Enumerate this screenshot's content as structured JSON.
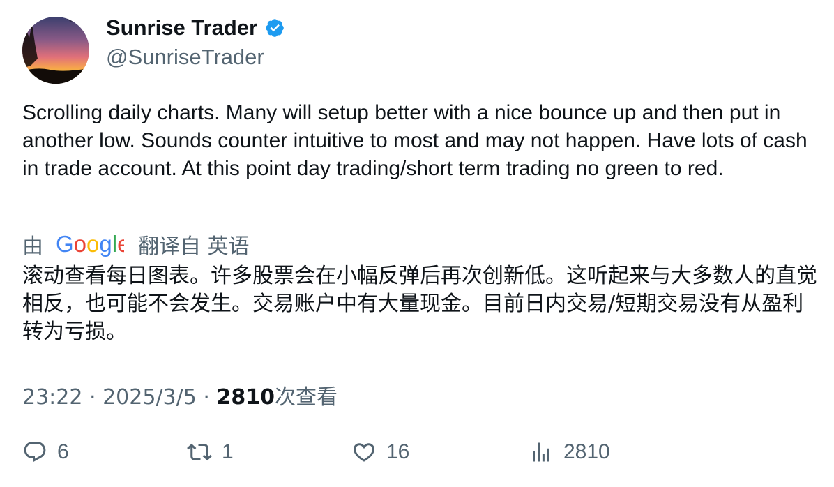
{
  "author": {
    "name": "Sunrise Trader",
    "handle": "@SunriseTrader",
    "verified_icon": "verified-badge-icon",
    "avatar_icon": "sunset-landscape-avatar"
  },
  "tweet": {
    "text": "Scrolling daily charts. Many will setup better with a nice bounce up and then put in another low. Sounds counter intuitive to most and may not happen.  Have lots of cash in trade account. At this point day trading/short term trading no green to red."
  },
  "translation": {
    "by_label": "由",
    "logo_text": "Google",
    "from_label": "翻译自 英语",
    "text": "滚动查看每日图表。许多股票会在小幅反弹后再次创新低。这听起来与大多数人的直觉相反，也可能不会发生。交易账户中有大量现金。目前日内交易/短期交易没有从盈利转为亏损。"
  },
  "meta": {
    "time": "23:22",
    "separator": "·",
    "date": "2025/3/5",
    "views_count": "2810",
    "views_label": "次查看"
  },
  "actions": {
    "reply_count": "6",
    "retweet_count": "1",
    "like_count": "16",
    "views_count": "2810"
  },
  "colors": {
    "text_primary": "#0f1419",
    "text_secondary": "#536471",
    "verified_blue": "#1d9bf0"
  }
}
